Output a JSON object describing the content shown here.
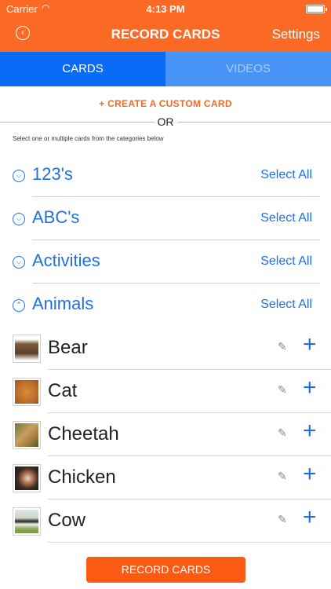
{
  "status_bar": {
    "carrier": "Carrier",
    "time": "4:13 PM"
  },
  "nav": {
    "title": "RECORD CARDS",
    "settings_label": "Settings",
    "back_icon": "back-circle-icon"
  },
  "tabs": [
    {
      "label": "CARDS",
      "active": true
    },
    {
      "label": "VIDEOS",
      "active": false
    }
  ],
  "create_custom_label": "+ CREATE A CUSTOM CARD",
  "or_label": "OR",
  "instructions": "Select one or multiple cards from the categories below",
  "select_all_label": "Select All",
  "categories": [
    {
      "name": "123's",
      "expanded": false
    },
    {
      "name": "ABC's",
      "expanded": false
    },
    {
      "name": "Activities",
      "expanded": false
    },
    {
      "name": "Animals",
      "expanded": true
    }
  ],
  "animals": [
    {
      "name": "Bear"
    },
    {
      "name": "Cat"
    },
    {
      "name": "Cheetah"
    },
    {
      "name": "Chicken"
    },
    {
      "name": "Cow"
    }
  ],
  "bottom_button_label": "RECORD CARDS",
  "colors": {
    "orange": "#fb6a25",
    "blue": "#0a6cf6",
    "link_blue": "#1f6fe5"
  }
}
